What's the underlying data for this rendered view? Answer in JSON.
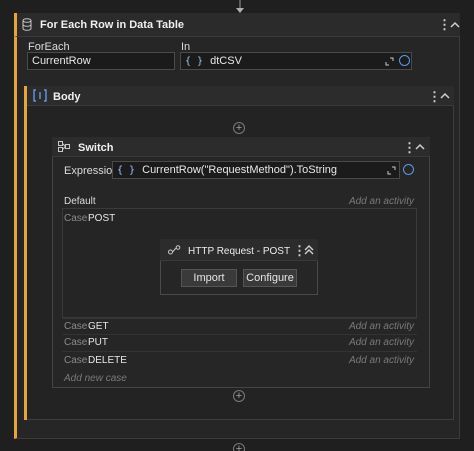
{
  "foreach_activity": {
    "title": "For Each Row in Data Table",
    "foreach_label": "ForEach",
    "foreach_value": "CurrentRow",
    "in_label": "In",
    "in_value": "dtCSV"
  },
  "body": {
    "title": "Body"
  },
  "switch_activity": {
    "title": "Switch",
    "expression_label": "Expression",
    "expression_value": "CurrentRow(\"RequestMethod\").ToString",
    "default_label": "Default",
    "add_activity": "Add an activity",
    "case_keyword": "Case",
    "cases": [
      {
        "value": "POST"
      },
      {
        "value": "GET",
        "placeholder": "Add an activity"
      },
      {
        "value": "PUT",
        "placeholder": "Add an activity"
      },
      {
        "value": "DELETE",
        "placeholder": "Add an activity"
      }
    ],
    "add_new_case": "Add new case"
  },
  "http_request": {
    "title": "HTTP Request - POST",
    "import_label": "Import",
    "configure_label": "Configure"
  },
  "glyphs": {
    "plus": "+",
    "kebab": "⋮",
    "brace": "{ }"
  },
  "colors": {
    "accent": "#e8a33c",
    "link_blue": "#5a9ae6"
  }
}
